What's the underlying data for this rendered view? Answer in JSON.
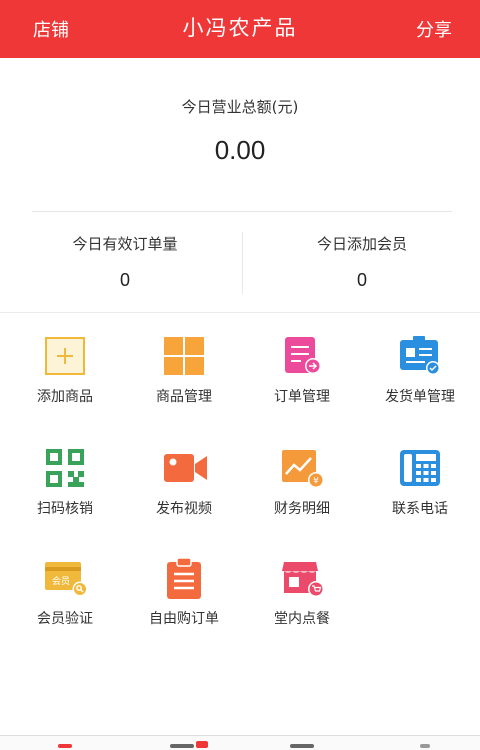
{
  "header": {
    "left": "店铺",
    "title": "小冯农产品",
    "right": "分享"
  },
  "sales": {
    "label": "今日营业总额(元)",
    "value": "0.00"
  },
  "stats": {
    "orders": {
      "label": "今日有效订单量",
      "value": "0"
    },
    "members": {
      "label": "今日添加会员",
      "value": "0"
    }
  },
  "grid": [
    {
      "label": "添加商品",
      "icon": "add-product-icon"
    },
    {
      "label": "商品管理",
      "icon": "product-management-icon"
    },
    {
      "label": "订单管理",
      "icon": "order-management-icon"
    },
    {
      "label": "发货单管理",
      "icon": "shipping-management-icon"
    },
    {
      "label": "扫码核销",
      "icon": "qr-code-icon"
    },
    {
      "label": "发布视频",
      "icon": "video-camera-icon"
    },
    {
      "label": "财务明细",
      "icon": "finance-chart-icon"
    },
    {
      "label": "联系电话",
      "icon": "phone-icon"
    },
    {
      "label": "会员验证",
      "icon": "member-card-icon"
    },
    {
      "label": "自由购订单",
      "icon": "clipboard-icon"
    },
    {
      "label": "堂内点餐",
      "icon": "dine-in-shop-icon"
    }
  ],
  "colors": {
    "header": "#ef3737"
  }
}
